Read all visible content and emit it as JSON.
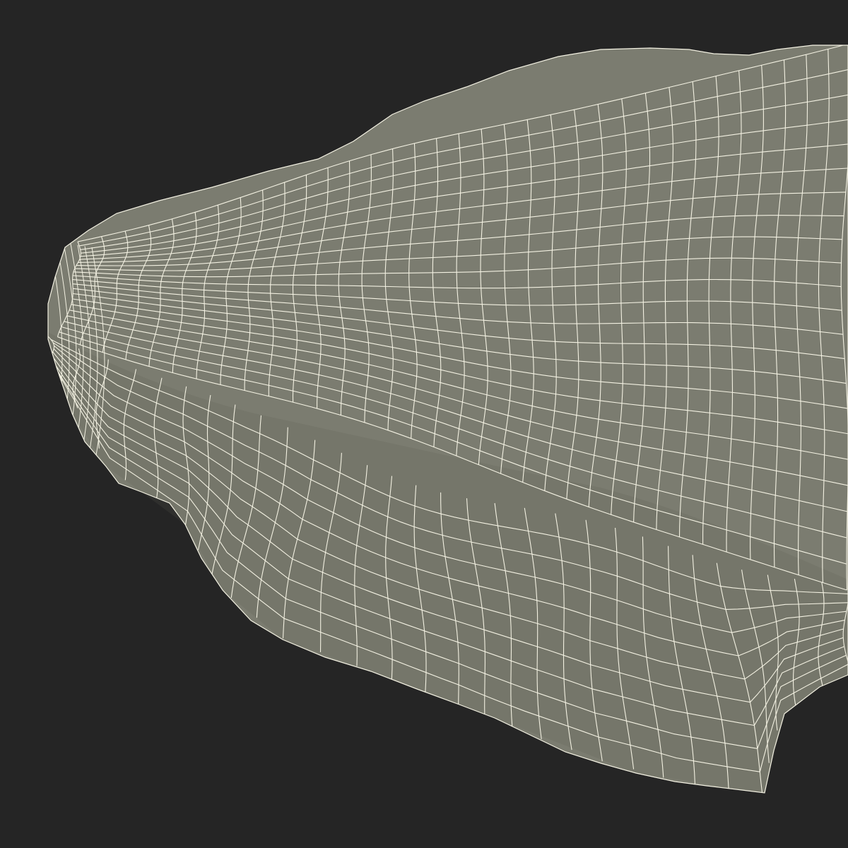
{
  "scene": {
    "background_color": "#252525",
    "surface_color": "#7b7c70",
    "wire_color": "#f3f1e2",
    "shadow_color": "#5f6055",
    "subject": "cushion-wireframe-mesh"
  }
}
